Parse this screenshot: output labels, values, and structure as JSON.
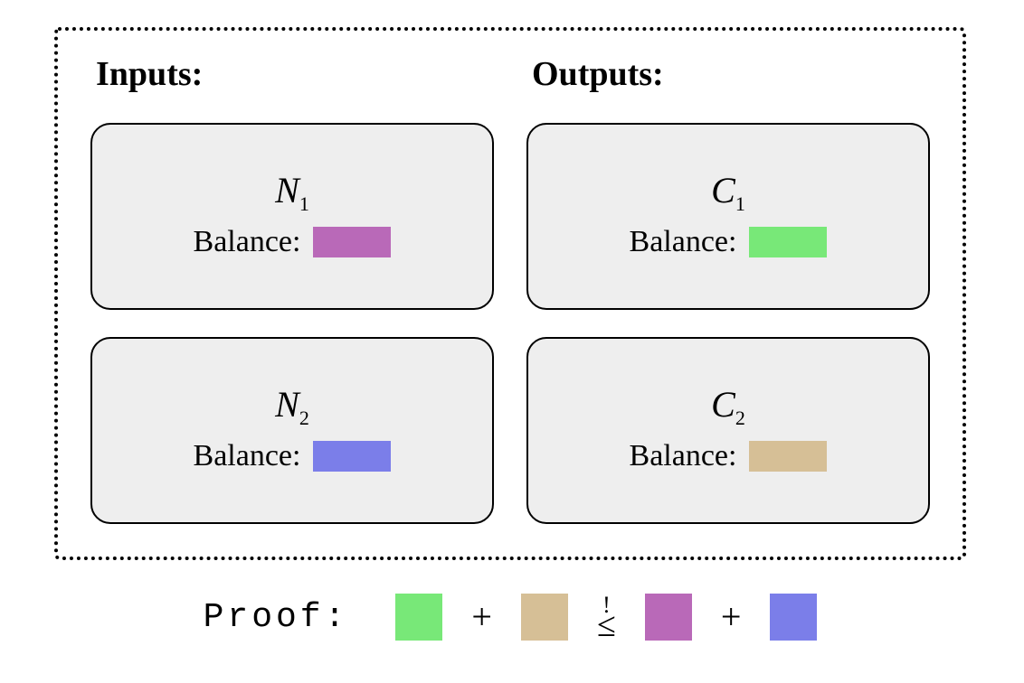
{
  "headers": {
    "inputs": "Inputs:",
    "outputs": "Outputs:"
  },
  "notes": {
    "inputs": [
      {
        "id_letter": "N",
        "id_sub": "1",
        "balance_label": "Balance:",
        "color": "#b969b8"
      },
      {
        "id_letter": "N",
        "id_sub": "2",
        "balance_label": "Balance:",
        "color": "#7b7ee9"
      }
    ],
    "outputs": [
      {
        "id_letter": "C",
        "id_sub": "1",
        "balance_label": "Balance:",
        "color": "#78e878"
      },
      {
        "id_letter": "C",
        "id_sub": "2",
        "balance_label": "Balance:",
        "color": "#d6bf96"
      }
    ]
  },
  "proof": {
    "label": "Proof:",
    "terms": [
      {
        "color": "#78e878"
      },
      {
        "color": "#d6bf96"
      },
      {
        "color": "#b969b8"
      },
      {
        "color": "#7b7ee9"
      }
    ],
    "plus": "+",
    "rel_top": "!",
    "rel_bottom": "≤"
  }
}
